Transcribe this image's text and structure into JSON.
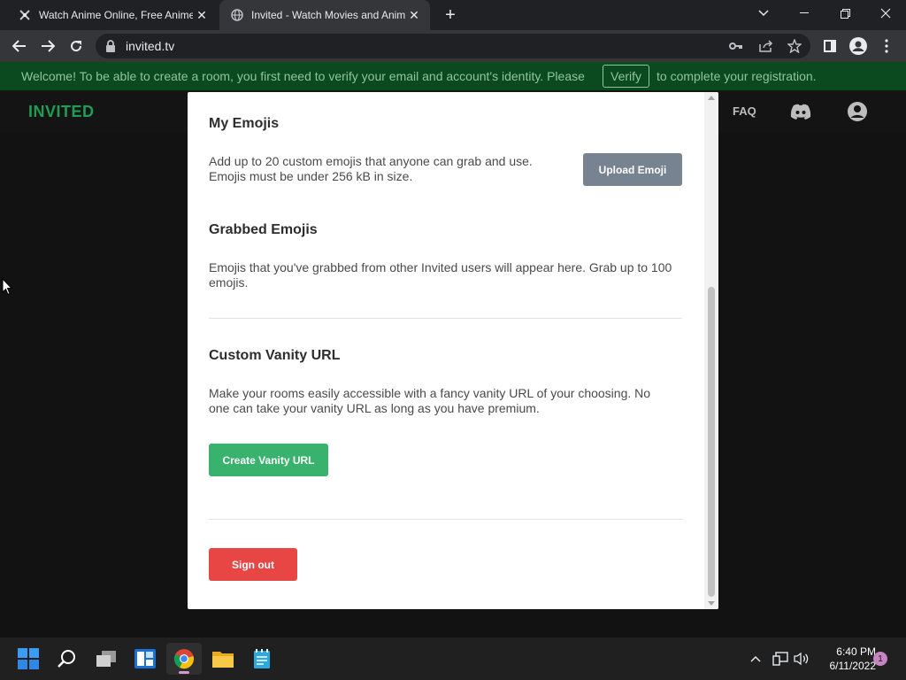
{
  "browser": {
    "tabs": [
      {
        "title": "Watch Anime Online, Free Anime",
        "favicon": "anime-favicon",
        "active": false
      },
      {
        "title": "Invited - Watch Movies and Anime",
        "favicon": "globe-favicon",
        "active": true
      }
    ],
    "url": "invited.tv"
  },
  "banner": {
    "message": "Welcome! To be able to create a room, you first need to verify your email and account's identity. Please",
    "verify_label": "Verify",
    "message_end": "to complete your registration."
  },
  "site": {
    "logo": "INVITED",
    "nav_faq": "FAQ"
  },
  "modal": {
    "my_emojis": {
      "title": "My Emojis",
      "desc_line1": "Add up to 20 custom emojis that anyone can grab and use.",
      "desc_line2": "Emojis must be under 256 kB in size.",
      "upload_label": "Upload Emoji"
    },
    "grabbed_emojis": {
      "title": "Grabbed Emojis",
      "desc_line1": "Emojis that you've grabbed from other Invited users will appear here. Grab up to 100",
      "desc_line2": "emojis."
    },
    "vanity": {
      "title": "Custom Vanity URL",
      "desc_line1": "Make your rooms easily accessible with a fancy vanity URL of your choosing. No",
      "desc_line2": "one can take your vanity URL as long as you have premium.",
      "create_label": "Create Vanity URL"
    },
    "sign_out_label": "Sign out"
  },
  "taskbar": {
    "time": "6:40 PM",
    "date": "6/11/2022",
    "notification_count": "1"
  },
  "colors": {
    "brand_green": "#1f9d55",
    "banner_bg": "#0a4a1e",
    "create_button": "#38b26c",
    "sign_out_button": "#e84545",
    "upload_button": "#778391"
  }
}
